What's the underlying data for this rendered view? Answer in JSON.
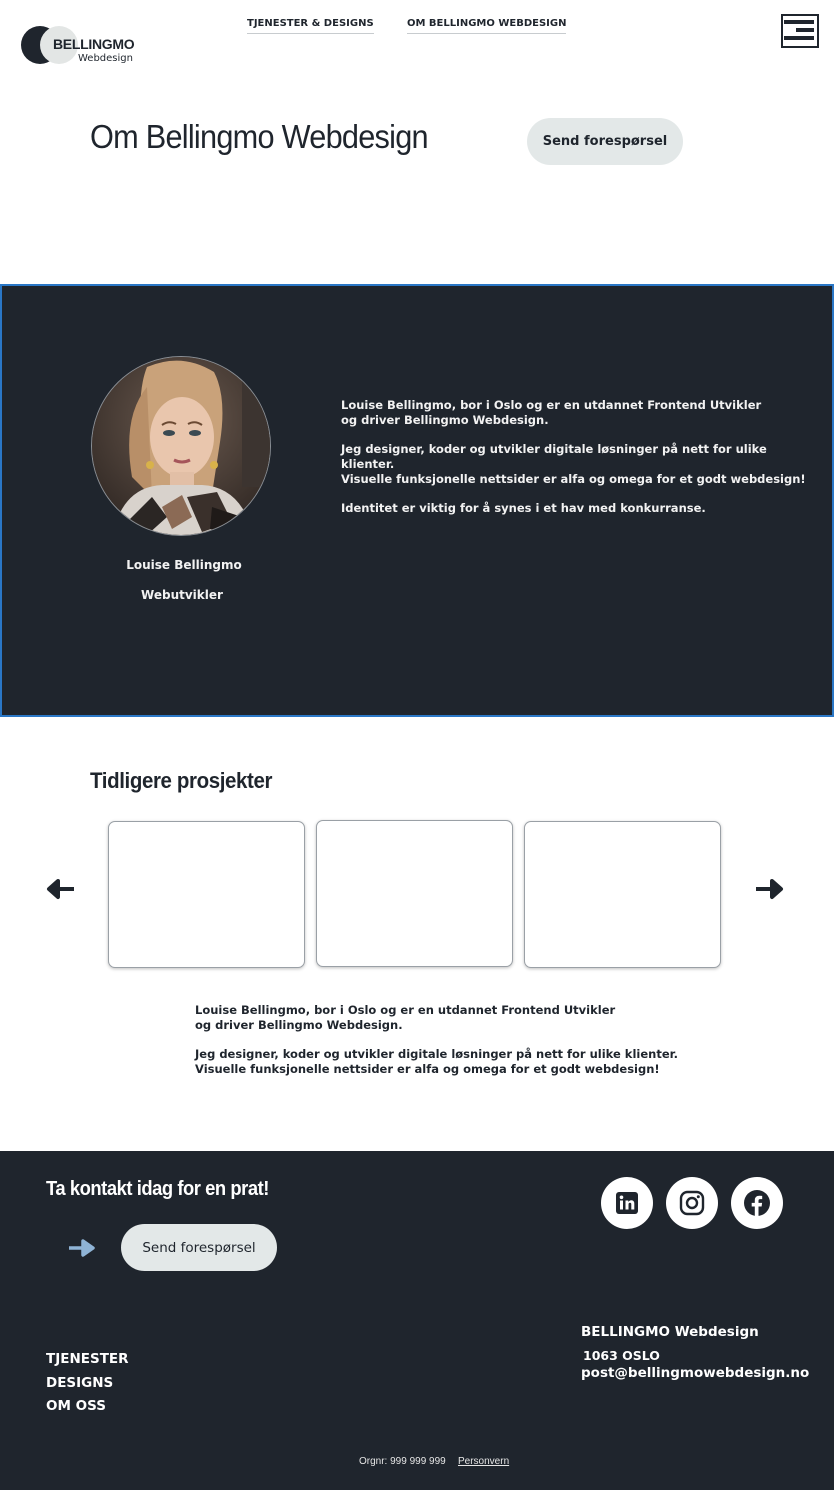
{
  "brand": {
    "name": "BELLINGMO",
    "sub": "Webdesign"
  },
  "nav": {
    "services": "TJENESTER & DESIGNS",
    "about": "OM BELLINGMO WEBDESIGN"
  },
  "hero": {
    "title": "Om Bellingmo Webdesign",
    "cta": "Send forespørsel"
  },
  "about": {
    "name": "Louise Bellingmo",
    "role": "Webutvikler",
    "paragraphs": [
      "Louise Bellingmo, bor i Oslo og er en utdannet Frontend Utvikler\nog driver Bellingmo Webdesign.",
      "Jeg designer, koder og utvikler digitale løsninger på nett for ulike klienter.\nVisuelle funksjonelle nettsider er alfa og omega for et godt webdesign!",
      "Identitet er viktig for å synes i et hav med konkurranse."
    ]
  },
  "projects": {
    "title": "Tidligere prosjekter",
    "paragraphs": [
      "Louise Bellingmo, bor i Oslo og er en utdannet Frontend Utvikler\nog driver Bellingmo Webdesign.",
      "Jeg designer, koder og utvikler digitale løsninger på nett for ulike klienter.\nVisuelle funksjonelle nettsider er alfa og omega for et godt webdesign!"
    ]
  },
  "footer": {
    "cta_title": "Ta kontakt idag for en prat!",
    "cta_button": "Send forespørsel",
    "nav": [
      "TJENESTER",
      "DESIGNS",
      "OM OSS"
    ],
    "company": "BELLINGMO Webdesign",
    "city": "1063 OSLO",
    "email": "post@bellingmowebdesign.no",
    "orgnr": "Orgnr: 999 999 999",
    "privacy": "Personvern"
  },
  "icons": {
    "menu": "hamburger-menu-icon",
    "prev": "arrow-left-icon",
    "next": "arrow-right-icon",
    "social": [
      "linkedin-icon",
      "instagram-icon",
      "facebook-icon"
    ]
  },
  "colors": {
    "dark": "#1f252d",
    "pill": "#e3e8e8",
    "accent_arrow": "#8fb4d6",
    "border_blue": "#2a77c6"
  }
}
